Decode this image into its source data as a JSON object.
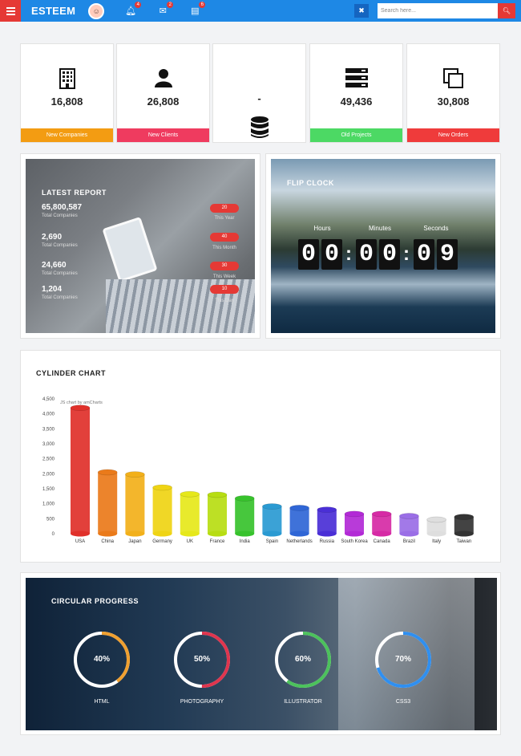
{
  "topbar": {
    "brand": "ESTEEM",
    "notifications_count": "4",
    "messages_count": "2",
    "tasks_count": "6",
    "search_placeholder": "Search here..."
  },
  "stats": [
    {
      "value": "16,808",
      "label": "New Companies",
      "color": "#f39c12",
      "icon": "building-icon"
    },
    {
      "value": "26,808",
      "label": "New Clients",
      "color": "#ef3b5f",
      "icon": "user-icon"
    },
    {
      "value": "-",
      "label": "",
      "color": "#ffffff",
      "icon": "database-icon"
    },
    {
      "value": "49,436",
      "label": "Old Projects",
      "color": "#4cd964",
      "icon": "server-icon"
    },
    {
      "value": "30,808",
      "label": "New Orders",
      "color": "#ef3b3b",
      "icon": "copy-icon"
    }
  ],
  "report": {
    "title": "LATEST REPORT",
    "rows": [
      {
        "value": "65,800,587",
        "label": "Total Companies",
        "pill": "20",
        "period": "This Year"
      },
      {
        "value": "2,690",
        "label": "Total Companies",
        "pill": "40",
        "period": "This Month"
      },
      {
        "value": "24,660",
        "label": "Total Companies",
        "pill": "30",
        "period": "This Week"
      },
      {
        "value": "1,204",
        "label": "Total Companies",
        "pill": "10",
        "period": "This Day"
      }
    ]
  },
  "clock": {
    "title": "FLIP CLOCK",
    "hours_label": "Hours",
    "minutes_label": "Minutes",
    "seconds_label": "Seconds",
    "digits": [
      "0",
      "0",
      "0",
      "0",
      "0",
      "9"
    ]
  },
  "cylinder": {
    "title": "CYLINDER CHART",
    "credit": "JS chart by amCharts"
  },
  "chart_data": {
    "type": "bar",
    "categories": [
      "USA",
      "China",
      "Japan",
      "Germany",
      "UK",
      "France",
      "India",
      "Spain",
      "Netherlands",
      "Russia",
      "South Korea",
      "Canada",
      "Brazil",
      "Italy",
      "Taiwan"
    ],
    "values": [
      4200,
      2050,
      1980,
      1540,
      1320,
      1300,
      1180,
      910,
      860,
      800,
      660,
      660,
      590,
      470,
      560
    ],
    "colors": [
      "#e0302a",
      "#ea7a1a",
      "#f2b01a",
      "#efd414",
      "#e6e81a",
      "#b7dd12",
      "#37c22c",
      "#2a9ad2",
      "#2f66d6",
      "#4a2fd6",
      "#b22ad6",
      "#d62aa5",
      "#9a6ee6",
      "#dedede",
      "#333333"
    ],
    "yticks": [
      0,
      500,
      1000,
      1500,
      2000,
      2500,
      3000,
      3500,
      4000,
      4500
    ],
    "ytick_labels": [
      "0",
      "500",
      "1,000",
      "1,500",
      "2,000",
      "2,500",
      "3,000",
      "3,500",
      "4,000",
      "4,500"
    ],
    "ylim": [
      0,
      4500
    ]
  },
  "circular": {
    "title": "CIRCULAR PROGRESS",
    "items": [
      {
        "pct": "40%",
        "label": "HTML",
        "value": 0.4,
        "color": "#f0a030"
      },
      {
        "pct": "50%",
        "label": "PHOTOGRAPHY",
        "value": 0.5,
        "color": "#e0354e"
      },
      {
        "pct": "60%",
        "label": "ILLUSTRATOR",
        "value": 0.6,
        "color": "#4cc25c"
      },
      {
        "pct": "70%",
        "label": "CSS3",
        "value": 0.7,
        "color": "#2f8ff0"
      }
    ]
  }
}
